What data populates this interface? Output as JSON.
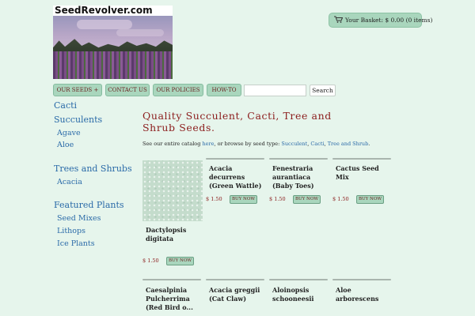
{
  "site": {
    "logo_text": "SeedRevolver.com"
  },
  "basket": {
    "label": "Your Basket: $ 0.00 (0 items)"
  },
  "nav": {
    "items": [
      "OUR SEEDS +",
      "CONTACT US",
      "OUR POLICIES",
      "HOW-TO"
    ],
    "search_button": "Search",
    "search_placeholder": ""
  },
  "sidebar": {
    "groups": [
      {
        "label": "Cacti",
        "children": []
      },
      {
        "label": "Succulents",
        "children": [
          "Agave",
          "Aloe"
        ]
      },
      {
        "label": "Trees and Shrubs",
        "children": [
          "Acacia"
        ]
      },
      {
        "label": "Featured Plants",
        "children": [
          "Seed Mixes",
          "Lithops",
          "Ice Plants"
        ]
      }
    ]
  },
  "main": {
    "title": "Quality Succulent, Cacti, Tree and Shrub Seeds.",
    "intro_before": "See our entire catalog ",
    "intro_link": "here",
    "intro_mid": ", or browse by seed type: ",
    "intro_succulent": "Succulent",
    "intro_sep1": ", ",
    "intro_cacti": "Cacti",
    "intro_sep2": ", ",
    "intro_tree": "Tree and Shrub",
    "intro_end": "."
  },
  "products": [
    {
      "name": "Dactylopsis digitata",
      "price": "$ 1.50",
      "button": "BUY NOW"
    },
    {
      "name": "Acacia decurrens (Green Wattle)",
      "price": "$ 1.50",
      "button": "BUY NOW"
    },
    {
      "name": "Fenestraria aurantiaca (Baby Toes)",
      "price": "$ 1.50",
      "button": "BUY NOW"
    },
    {
      "name": "Cactus Seed Mix",
      "price": "$ 1.50",
      "button": "BUY NOW"
    },
    {
      "name": "Caesalpinia Pulcherrima (Red Bird o...",
      "price": "",
      "button": ""
    },
    {
      "name": "Acacia greggii (Cat Claw)",
      "price": "",
      "button": ""
    },
    {
      "name": "Aloinopsis schooneesii",
      "price": "",
      "button": ""
    },
    {
      "name": "Aloe arborescens",
      "price": "",
      "button": ""
    }
  ],
  "colors": {
    "background": "#e6f5ec",
    "button": "#a9d6bd",
    "title": "#8b1c1c",
    "link": "#2a6aa8"
  },
  "icons": {
    "basket": "cart-icon"
  }
}
